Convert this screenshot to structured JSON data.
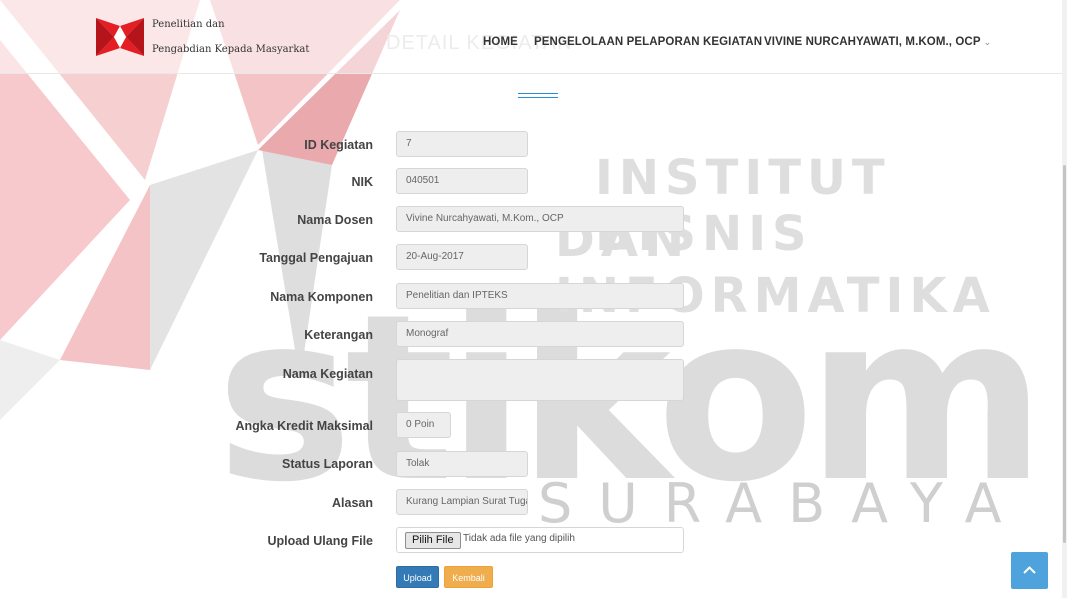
{
  "brand": {
    "line1": "Penelitian dan",
    "line2": "Pengabdian Kepada Masyarkat",
    "logo_colors": [
      "#e31e24",
      "#f8c4c6",
      "#dcdcdc"
    ]
  },
  "header": {
    "ghost_title": "DETAIL KEGIATAN"
  },
  "nav": {
    "home": "HOME",
    "pengelolaan": "PENGELOLAAN PELAPORAN KEGIATAN",
    "user": "VIVINE NURCAHYAWATI, M.KOM., OCP",
    "caret": "⌄"
  },
  "watermark": {
    "line1": "INSTITUT BISNIS",
    "line2": "DAN INFORMATIKA",
    "word": "stikom",
    "city": "SURABAYA"
  },
  "form": {
    "id_kegiatan": {
      "label": "ID Kegiatan",
      "value": "7"
    },
    "nik": {
      "label": "NIK",
      "value": "040501"
    },
    "nama_dosen": {
      "label": "Nama Dosen",
      "value": "Vivine Nurcahyawati, M.Kom., OCP"
    },
    "tanggal_pengajuan": {
      "label": "Tanggal Pengajuan",
      "value": "20-Aug-2017"
    },
    "nama_komponen": {
      "label": "Nama Komponen",
      "value": "Penelitian dan IPTEKS"
    },
    "keterangan": {
      "label": "Keterangan",
      "value": "Monograf"
    },
    "nama_kegiatan": {
      "label": "Nama Kegiatan",
      "value": ""
    },
    "angka_kredit": {
      "label": "Angka Kredit Maksimal",
      "value": "0 Poin"
    },
    "status_laporan": {
      "label": "Status Laporan",
      "value": "Tolak"
    },
    "alasan": {
      "label": "Alasan",
      "value": "Kurang Lampian Surat Tugas"
    },
    "upload_ulang": {
      "label": "Upload Ulang File",
      "button": "Pilih File",
      "status": "Tidak ada file yang dipilih"
    }
  },
  "buttons": {
    "upload": "Upload",
    "back": "Kembali"
  },
  "colors": {
    "accent": "#337ab7",
    "warning": "#f0ad4e",
    "scroll_top": "#4fa3dd",
    "logo_red": "#e31e24"
  }
}
